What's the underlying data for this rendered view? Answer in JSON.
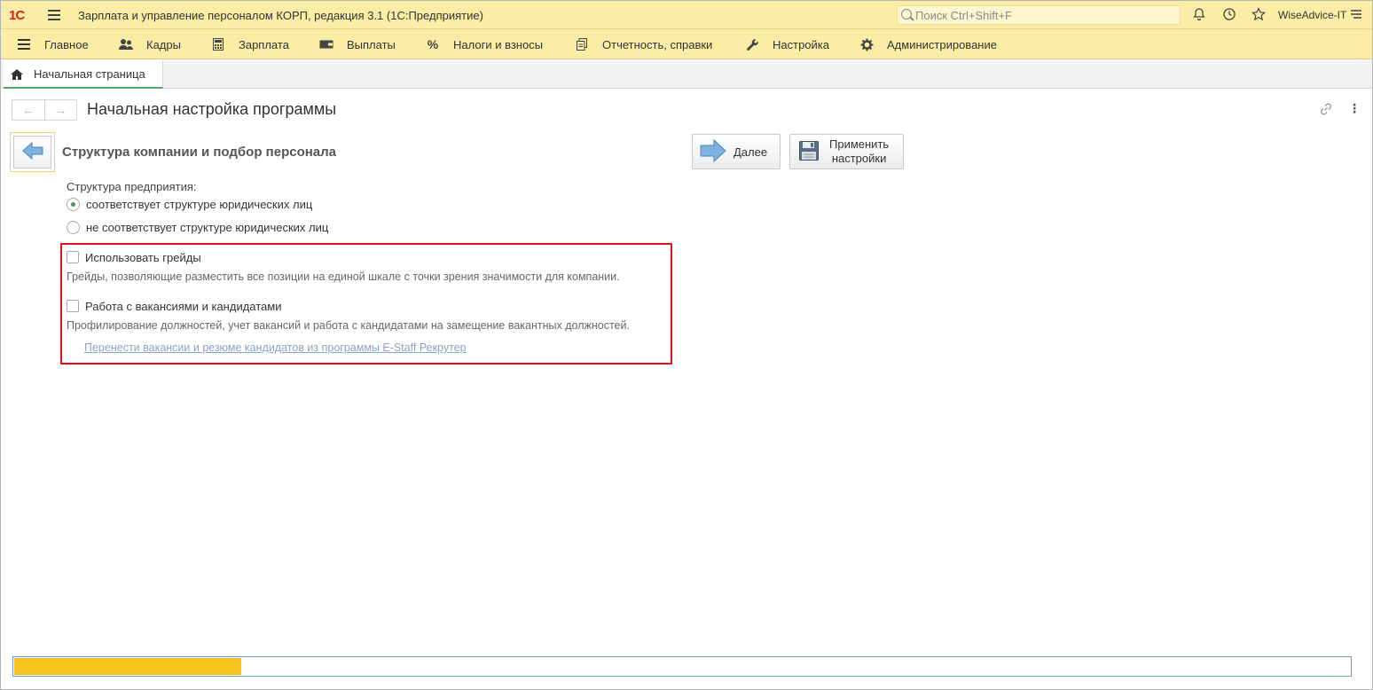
{
  "titlebar": {
    "logo": "1С",
    "app_title": "Зарплата и управление персоналом КОРП, редакция 3.1  (1С:Предприятие)",
    "search_placeholder": "Поиск Ctrl+Shift+F",
    "user": "WiseAdvice-IT"
  },
  "menu": {
    "items": [
      {
        "label": "Главное",
        "icon": "hamburger-icon"
      },
      {
        "label": "Кадры",
        "icon": "people-icon"
      },
      {
        "label": "Зарплата",
        "icon": "calculator-icon"
      },
      {
        "label": "Выплаты",
        "icon": "wallet-icon"
      },
      {
        "label": "Налоги и взносы",
        "icon": "percent-icon"
      },
      {
        "label": "Отчетность, справки",
        "icon": "reports-icon"
      },
      {
        "label": "Настройка",
        "icon": "wrench-icon"
      },
      {
        "label": "Администрирование",
        "icon": "gear-icon"
      }
    ]
  },
  "tabs": [
    {
      "label": "Начальная страница",
      "icon": "home-icon",
      "active": true
    }
  ],
  "page": {
    "title": "Начальная настройка программы",
    "section_title": "Структура компании и подбор персонала",
    "next_label": "Далее",
    "apply_label_line1": "Применить",
    "apply_label_line2": "настройки",
    "structure_label": "Структура предприятия:",
    "radio_options": [
      {
        "label": "соответствует структуре юридических лиц",
        "checked": true
      },
      {
        "label": "не соответствует структуре юридических лиц",
        "checked": false
      }
    ],
    "grades_checkbox": {
      "label": "Использовать грейды",
      "checked": false
    },
    "grades_hint": "Грейды, позволяющие разместить все позиции на единой шкале с точки зрения значимости для компании.",
    "vacancies_checkbox": {
      "label": "Работа с вакансиями и кандидатами",
      "checked": false
    },
    "vacancies_hint": "Профилирование должностей, учет вакансий и работа с кандидатами на замещение вакантных должностей.",
    "transfer_link": "Перенести вакансии и резюме кандидатов из программы E-Staff Рекрутер"
  },
  "progress": {
    "value": 0.17
  },
  "colors": {
    "header_bg": "#fbeda5",
    "accent_green": "#4fa86b",
    "highlight_red": "#e0131c",
    "progress_fill": "#f6c31d",
    "progress_border": "#6a9fc9"
  }
}
